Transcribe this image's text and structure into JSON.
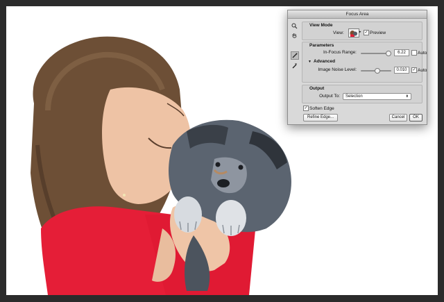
{
  "dialog": {
    "title": "Focus Area",
    "view_mode": {
      "heading": "View Mode",
      "view_label": "View:",
      "preview_label": "Preview",
      "preview_checked": true
    },
    "parameters": {
      "heading": "Parameters",
      "in_focus_label": "In-Focus Range:",
      "in_focus_value": "6.22",
      "in_focus_auto_label": "Auto",
      "in_focus_auto_checked": false,
      "advanced_heading": "Advanced",
      "noise_label": "Image Noise Level:",
      "noise_value": "0.010",
      "noise_auto_label": "Auto",
      "noise_auto_checked": true
    },
    "output": {
      "heading": "Output",
      "output_to_label": "Output To:",
      "output_to_value": "Selection"
    },
    "soften_edge_label": "Soften Edge",
    "soften_edge_checked": true,
    "buttons": {
      "refine_edge": "Refine Edge...",
      "cancel": "Cancel",
      "ok": "OK"
    }
  },
  "icons": {
    "tools": [
      "zoom-icon",
      "hand-icon",
      "focus-add-brush-icon",
      "focus-subtract-brush-icon"
    ],
    "expand_triangle": "▼",
    "select_arrows": "⬍",
    "checkmark": "✓"
  }
}
